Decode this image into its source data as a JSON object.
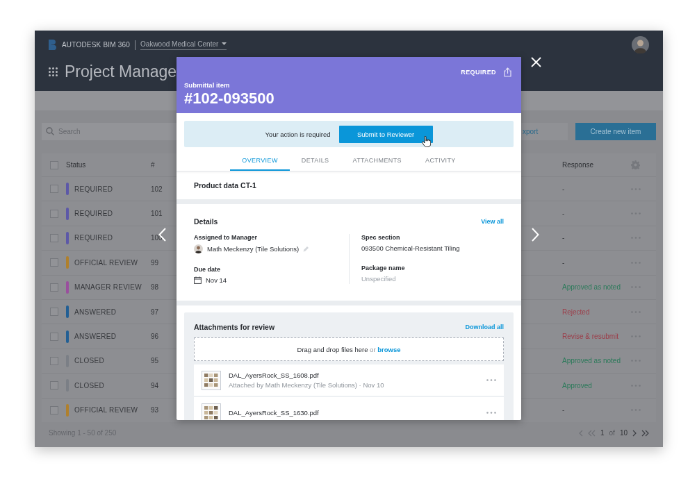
{
  "topbar": {
    "brand": "AUTODESK BIM 360",
    "project": "Oakwood Medical Center",
    "page_title": "Project Manage"
  },
  "toolbar": {
    "search": {
      "placeholder": "Search"
    },
    "export": "xport",
    "create": "Create new item"
  },
  "table": {
    "select_all_checked": false,
    "columns": [
      "Status",
      "#",
      "Response"
    ],
    "rows": [
      {
        "checked": false,
        "status": "REQUIRED",
        "color": "#5c58a8",
        "number": "102",
        "response": {
          "text": "-"
        }
      },
      {
        "checked": false,
        "status": "REQUIRED",
        "color": "#5c58a8",
        "number": "101",
        "response": {
          "text": "-"
        }
      },
      {
        "checked": false,
        "status": "REQUIRED",
        "color": "#5c58a8",
        "number": "100",
        "response": {
          "text": "-"
        }
      },
      {
        "checked": false,
        "status": "OFFICIAL REVIEW",
        "color": "#b0802c",
        "number": "99",
        "response": {
          "text": "-"
        }
      },
      {
        "checked": false,
        "status": "MANAGER REVIEW",
        "color": "#9a4f9e",
        "number": "98",
        "response": {
          "text": "Approved as noted",
          "color": "#2b7a5a"
        }
      },
      {
        "checked": false,
        "status": "ANSWERED",
        "color": "#225f94",
        "number": "97",
        "response": {
          "text": "Rejected",
          "color": "#9c3c48"
        }
      },
      {
        "checked": false,
        "status": "ANSWERED",
        "color": "#225f94",
        "number": "96",
        "response": {
          "text": "Revise & resubmit",
          "color": "#9c3c48"
        }
      },
      {
        "checked": false,
        "status": "CLOSED",
        "color": "#7b7f86",
        "number": "95",
        "response": {
          "text": "Approved as noted",
          "color": "#2b7a5a"
        }
      },
      {
        "checked": false,
        "status": "CLOSED",
        "color": "#7b7f86",
        "number": "94",
        "response": {
          "text": "Approved",
          "color": "#2b7a5a"
        }
      },
      {
        "checked": false,
        "status": "OFFICIAL REVIEW",
        "color": "#b0802c",
        "number": "93",
        "response": {
          "text": "-"
        }
      }
    ]
  },
  "footer": {
    "showing": "Showing 1 - 50 of 250",
    "current": "1",
    "of": "of",
    "total": "10"
  },
  "modal": {
    "status": "REQUIRED",
    "label": "Submittal item",
    "title": "#102-093500",
    "action_text": "Your action is required",
    "action_button": "Submit to Reviewer",
    "tabs": [
      {
        "label": "OVERVIEW",
        "selected": true
      },
      {
        "label": "DETAILS",
        "selected": false
      },
      {
        "label": "ATTACHMENTS",
        "selected": false
      },
      {
        "label": "ACTIVITY",
        "selected": false
      }
    ],
    "product": "Product data CT-1",
    "details": {
      "title": "Details",
      "link": "View all",
      "columns": [
        [
          {
            "label": "Assigned to Manager",
            "value": "Math Meckenzy (Tile Solutions)",
            "kind": "person"
          },
          {
            "label": "Due date",
            "value": "Nov 14",
            "kind": "date"
          }
        ],
        [
          {
            "label": "Spec section",
            "value": "093500 Chemical-Resistant Tiling",
            "kind": "text"
          },
          {
            "label": "Package name",
            "value": "Unspecified",
            "kind": "empty"
          }
        ]
      ]
    },
    "attachments": {
      "title": "Attachments for review",
      "link": "Download all",
      "drop_text": "Drag and drop files here",
      "drop_or": "or",
      "drop_link": "browse",
      "files": [
        {
          "name": "DAL_AyersRock_SS_1608.pdf",
          "meta": "Attached by Math Meckenzy (Tile Solutions) · Nov 10"
        },
        {
          "name": "DAL_AyersRock_SS_1630.pdf"
        }
      ]
    }
  }
}
